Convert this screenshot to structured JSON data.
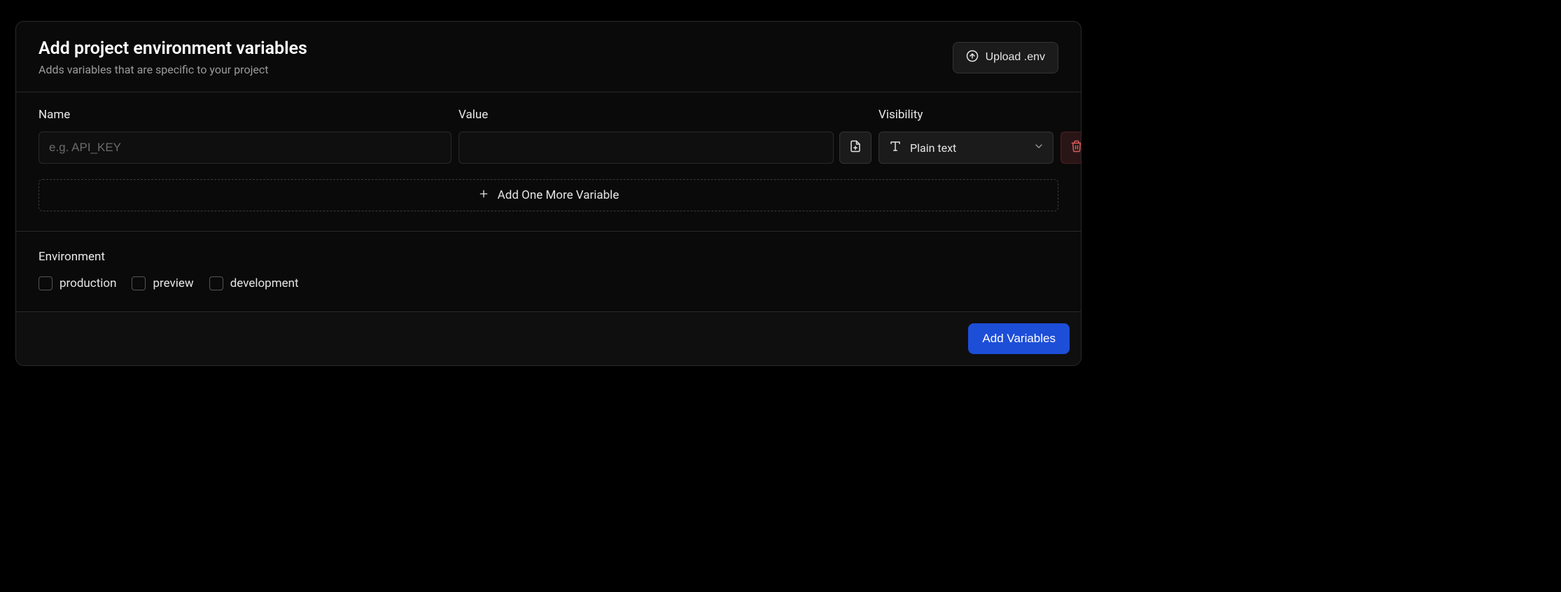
{
  "header": {
    "title": "Add project environment variables",
    "subtitle": "Adds variables that are specific to your project",
    "upload_label": "Upload .env"
  },
  "fields": {
    "name_label": "Name",
    "name_placeholder": "e.g. API_KEY",
    "name_value": "",
    "value_label": "Value",
    "value_value": "",
    "visibility_label": "Visibility",
    "visibility_selected": "Plain text"
  },
  "add_row_label": "Add One More Variable",
  "environment": {
    "title": "Environment",
    "options": {
      "production": "production",
      "preview": "preview",
      "development": "development"
    }
  },
  "footer": {
    "submit_label": "Add Variables"
  }
}
